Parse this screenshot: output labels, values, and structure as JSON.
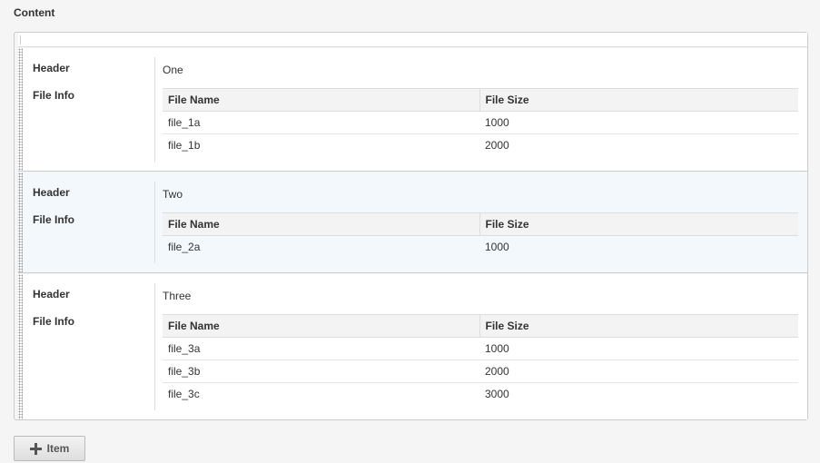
{
  "section": {
    "title": "Content"
  },
  "labels": {
    "header": "Header",
    "file_info": "File Info"
  },
  "columns": {
    "name": "File Name",
    "size": "File Size"
  },
  "items": [
    {
      "header": "One",
      "files": [
        {
          "name": "file_1a",
          "size": "1000"
        },
        {
          "name": "file_1b",
          "size": "2000"
        }
      ]
    },
    {
      "header": "Two",
      "files": [
        {
          "name": "file_2a",
          "size": "1000"
        }
      ]
    },
    {
      "header": "Three",
      "files": [
        {
          "name": "file_3a",
          "size": "1000"
        },
        {
          "name": "file_3b",
          "size": "2000"
        },
        {
          "name": "file_3c",
          "size": "3000"
        }
      ]
    }
  ],
  "add_button": {
    "label": "Item",
    "icon": "plus-icon"
  }
}
